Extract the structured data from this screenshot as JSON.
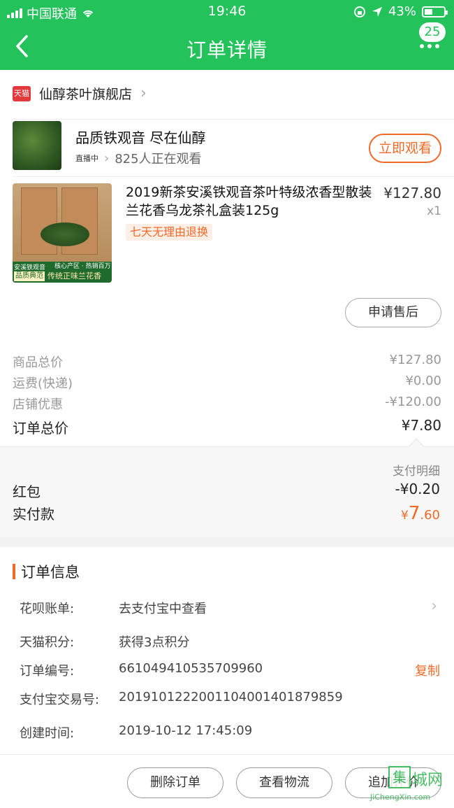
{
  "status_bar": {
    "carrier": "中国联通",
    "time": "19:46",
    "battery": "43%",
    "battery_level": 0.43
  },
  "nav": {
    "title": "订单详情",
    "badge": "25"
  },
  "shop": {
    "logo_text": "天猫",
    "name": "仙醇茶叶旗舰店"
  },
  "live": {
    "title": "品质铁观音 尽在仙醇",
    "tag": "直播中",
    "viewers": "825人正在观看",
    "watch_button": "立即观看"
  },
  "product": {
    "name": "2019新茶安溪铁观音茶叶特级浓香型散装兰花香乌龙茶礼盒装125g",
    "price": "¥127.80",
    "quantity": "x1",
    "return_tag": "七天无理由退换",
    "image_text": {
      "line1": "安溪铁观音",
      "line2": "品质典范",
      "line3": "核心产区 · 热销百万",
      "line4": "传统正味兰花香"
    },
    "after_sale_button": "申请售后"
  },
  "summary": {
    "rows": [
      {
        "label": "商品总价",
        "value": "¥127.80"
      },
      {
        "label": "运费(快递)",
        "value": "¥0.00"
      },
      {
        "label": "店铺优惠",
        "value": "-¥120.00"
      }
    ],
    "total_label": "订单总价",
    "total_value": "¥7.80"
  },
  "payment": {
    "detail_label": "支付明细",
    "red_packet_label": "红包",
    "red_packet_value": "-¥0.20",
    "paid_label": "实付款",
    "paid_currency": "¥",
    "paid_int": "7",
    "paid_dec": ".60"
  },
  "order_info": {
    "heading": "订单信息",
    "rows": [
      {
        "key": "花呗账单:",
        "value": "去支付宝中查看"
      },
      {
        "key": "天猫积分:",
        "value": "获得3点积分"
      },
      {
        "key": "订单编号:",
        "value": "661049410535709960",
        "action": "复制"
      },
      {
        "key": "支付宝交易号:",
        "value": "2019101222001104001401879859"
      },
      {
        "key": "创建时间:",
        "value": "2019-10-12 17:45:09"
      }
    ]
  },
  "bottom_bar": {
    "delete": "删除订单",
    "logistics": "查看物流",
    "review": "追加评价"
  },
  "watermark": {
    "mark": "集",
    "name": "城网",
    "url": "JiChengXin.com"
  },
  "colors": {
    "brand_green": "#23c25b",
    "accent_orange": "#f06a2a"
  }
}
